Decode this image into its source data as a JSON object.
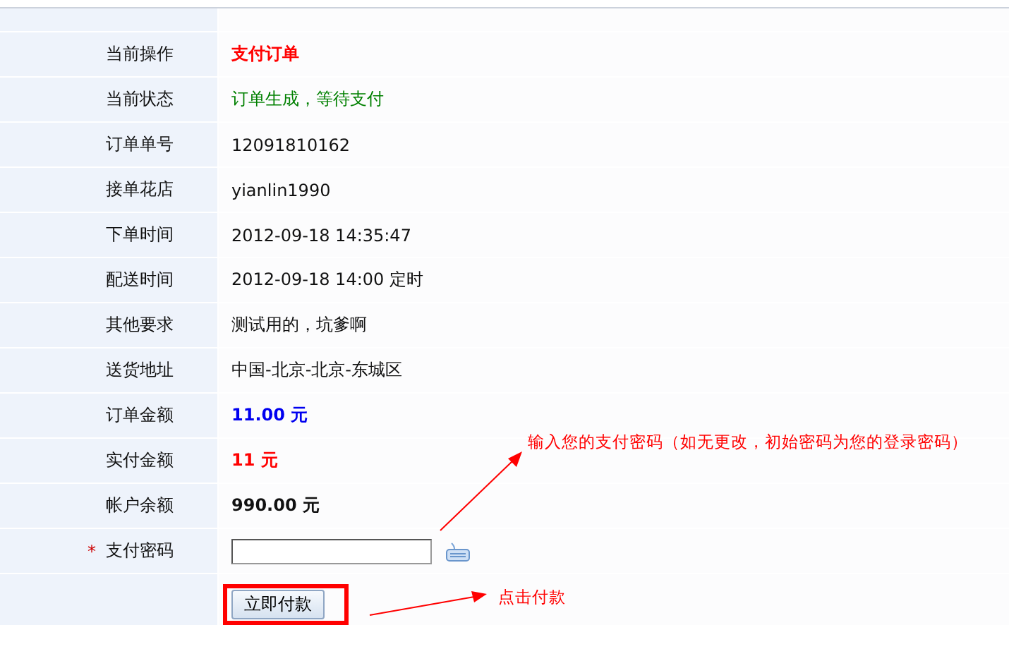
{
  "rows": [
    {
      "label": "当前操作",
      "value": "支付订单",
      "kind": "red"
    },
    {
      "label": "当前状态",
      "value": "订单生成，等待支付",
      "kind": "green"
    },
    {
      "label": "订单单号",
      "value": "12091810162",
      "kind": "plain"
    },
    {
      "label": "接单花店",
      "value": "yianlin1990",
      "kind": "plain"
    },
    {
      "label": "下单时间",
      "value": "2012-09-18 14:35:47",
      "kind": "plain"
    },
    {
      "label": "配送时间",
      "value": "2012-09-18 14:00 定时",
      "kind": "plain"
    },
    {
      "label": "其他要求",
      "value": "测试用的，坑爹啊",
      "kind": "plain"
    },
    {
      "label": "送货地址",
      "value": "中国-北京-北京-东城区",
      "kind": "plain"
    },
    {
      "label": "订单金额",
      "value": "11.00 元",
      "kind": "blue"
    },
    {
      "label": "实付金额",
      "value": "11 元",
      "kind": "red"
    },
    {
      "label": "帐户余额",
      "value": "990.00 元",
      "kind": "bold"
    }
  ],
  "password": {
    "required_mark": "*",
    "label": "支付密码"
  },
  "pay_button": "立即付款",
  "annotations": [
    "输入您的支付密码（如无更改，初始密码为您的登录密码）",
    "点击付款"
  ]
}
